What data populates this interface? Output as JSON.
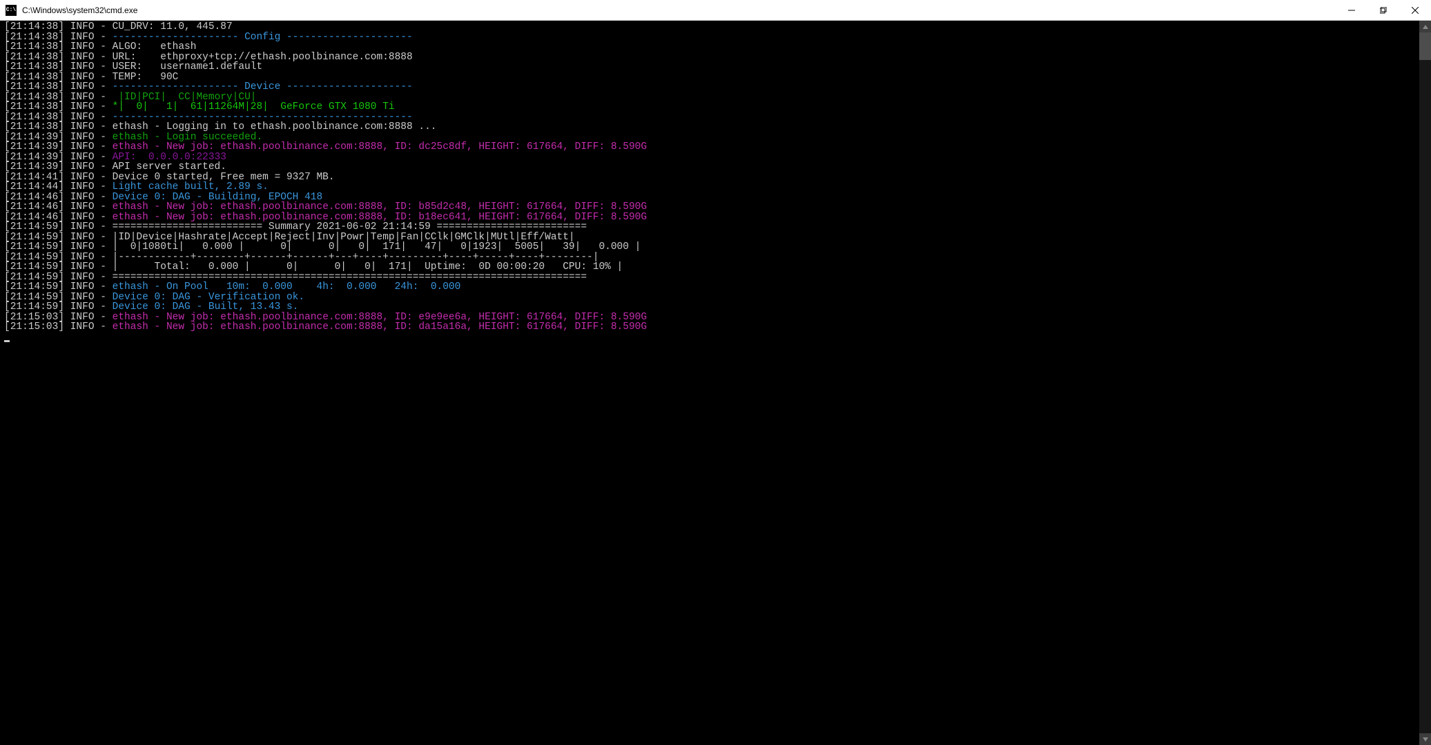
{
  "titlebar": {
    "title": "C:\\Windows\\system32\\cmd.exe"
  },
  "lines": [
    {
      "ts": "[21:14:38]",
      "segs": [
        {
          "c": "c-white",
          "t": " INFO - CU_DRV: 11.0, 445.87"
        }
      ]
    },
    {
      "ts": "[21:14:38]",
      "segs": [
        {
          "c": "c-white",
          "t": " INFO - "
        },
        {
          "c": "c-cyan",
          "t": "--------------------- Config ---------------------"
        }
      ]
    },
    {
      "ts": "[21:14:38]",
      "segs": [
        {
          "c": "c-white",
          "t": " INFO - ALGO:   ethash"
        }
      ]
    },
    {
      "ts": "[21:14:38]",
      "segs": [
        {
          "c": "c-white",
          "t": " INFO - URL:    ethproxy+tcp://ethash.poolbinance.com:8888"
        }
      ]
    },
    {
      "ts": "[21:14:38]",
      "segs": [
        {
          "c": "c-white",
          "t": " INFO - USER:   username1.default"
        }
      ]
    },
    {
      "ts": "[21:14:38]",
      "segs": [
        {
          "c": "c-white",
          "t": " INFO - TEMP:   90C"
        }
      ]
    },
    {
      "ts": "[21:14:38]",
      "segs": [
        {
          "c": "c-white",
          "t": " INFO - "
        },
        {
          "c": "c-cyan",
          "t": "--------------------- Device ---------------------"
        }
      ]
    },
    {
      "ts": "[21:14:38]",
      "segs": [
        {
          "c": "c-white",
          "t": " INFO - "
        },
        {
          "c": "c-green",
          "t": " |ID|PCI|  CC|Memory|CU|"
        }
      ]
    },
    {
      "ts": "[21:14:38]",
      "segs": [
        {
          "c": "c-white",
          "t": " INFO - "
        },
        {
          "c": "c-lgreen",
          "t": "*|  0|   1|  61|11264M|28|  GeForce GTX 1080 Ti"
        }
      ]
    },
    {
      "ts": "[21:14:38]",
      "segs": [
        {
          "c": "c-white",
          "t": " INFO - "
        },
        {
          "c": "c-cyan",
          "t": "--------------------------------------------------"
        }
      ]
    },
    {
      "ts": "[21:14:38]",
      "segs": [
        {
          "c": "c-white",
          "t": " INFO - ethash - Logging in to ethash.poolbinance.com:8888 ..."
        }
      ]
    },
    {
      "ts": "[21:14:39]",
      "segs": [
        {
          "c": "c-white",
          "t": " INFO - "
        },
        {
          "c": "c-green",
          "t": "ethash - Login succeeded."
        }
      ]
    },
    {
      "ts": "[21:14:39]",
      "segs": [
        {
          "c": "c-white",
          "t": " INFO - "
        },
        {
          "c": "c-magenta",
          "t": "ethash - New job: ethash.poolbinance.com:8888, ID: dc25c8df, HEIGHT: 617664, DIFF: 8.590G"
        }
      ]
    },
    {
      "ts": "[21:14:39]",
      "segs": [
        {
          "c": "c-white",
          "t": " INFO - "
        },
        {
          "c": "c-purple",
          "t": "API:  0.0.0.0:22333"
        }
      ]
    },
    {
      "ts": "[21:14:39]",
      "segs": [
        {
          "c": "c-white",
          "t": " INFO - API server started."
        }
      ]
    },
    {
      "ts": "[21:14:41]",
      "segs": [
        {
          "c": "c-white",
          "t": " INFO - Device 0 started, Free mem = 9327 MB."
        }
      ]
    },
    {
      "ts": "[21:14:44]",
      "segs": [
        {
          "c": "c-white",
          "t": " INFO - "
        },
        {
          "c": "c-cyan",
          "t": "Light cache built, 2.89 s."
        }
      ]
    },
    {
      "ts": "[21:14:46]",
      "segs": [
        {
          "c": "c-white",
          "t": " INFO - "
        },
        {
          "c": "c-cyan",
          "t": "Device 0: DAG - Building, EPOCH 418"
        }
      ]
    },
    {
      "ts": "[21:14:46]",
      "segs": [
        {
          "c": "c-white",
          "t": " INFO - "
        },
        {
          "c": "c-magenta",
          "t": "ethash - New job: ethash.poolbinance.com:8888, ID: b85d2c48, HEIGHT: 617664, DIFF: 8.590G"
        }
      ]
    },
    {
      "ts": "[21:14:46]",
      "segs": [
        {
          "c": "c-white",
          "t": " INFO - "
        },
        {
          "c": "c-magenta",
          "t": "ethash - New job: ethash.poolbinance.com:8888, ID: b18ec641, HEIGHT: 617664, DIFF: 8.590G"
        }
      ]
    },
    {
      "ts": "[21:14:59]",
      "segs": [
        {
          "c": "c-white",
          "t": " INFO - ========================= Summary 2021-06-02 21:14:59 ========================="
        }
      ]
    },
    {
      "ts": "[21:14:59]",
      "segs": [
        {
          "c": "c-white",
          "t": " INFO - |ID|Device|Hashrate|Accept|Reject|Inv|Powr|Temp|Fan|CClk|GMClk|MUtl|Eff/Watt|"
        }
      ]
    },
    {
      "ts": "[21:14:59]",
      "segs": [
        {
          "c": "c-white",
          "t": " INFO - |  0|1080ti|   0.000 |      0|      0|   0|  171|   47|   0|1923|  5005|   39|   0.000 |"
        }
      ]
    },
    {
      "ts": "[21:14:59]",
      "segs": [
        {
          "c": "c-white",
          "t": " INFO - |------------+--------+------+------+---+----+---------+----+-----+----+--------|"
        }
      ]
    },
    {
      "ts": "[21:14:59]",
      "segs": [
        {
          "c": "c-white",
          "t": " INFO - |      Total:   0.000 |      0|      0|   0|  171|  Uptime:  0D 00:00:20   CPU: 10% |"
        }
      ]
    },
    {
      "ts": "[21:14:59]",
      "segs": [
        {
          "c": "c-white",
          "t": " INFO - ==============================================================================="
        }
      ]
    },
    {
      "ts": "[21:14:59]",
      "segs": [
        {
          "c": "c-white",
          "t": " INFO - "
        },
        {
          "c": "c-cyan",
          "t": "ethash - On Pool   10m:  0.000    4h:  0.000   24h:  0.000"
        }
      ]
    },
    {
      "ts": "[21:14:59]",
      "segs": [
        {
          "c": "c-white",
          "t": " INFO - "
        },
        {
          "c": "c-cyan",
          "t": "Device 0: DAG - Verification ok."
        }
      ]
    },
    {
      "ts": "[21:14:59]",
      "segs": [
        {
          "c": "c-white",
          "t": " INFO - "
        },
        {
          "c": "c-cyan",
          "t": "Device 0: DAG - Built, 13.43 s."
        }
      ]
    },
    {
      "ts": "[21:15:03]",
      "segs": [
        {
          "c": "c-white",
          "t": " INFO - "
        },
        {
          "c": "c-magenta",
          "t": "ethash - New job: ethash.poolbinance.com:8888, ID: e9e9ee6a, HEIGHT: 617664, DIFF: 8.590G"
        }
      ]
    },
    {
      "ts": "[21:15:03]",
      "segs": [
        {
          "c": "c-white",
          "t": " INFO - "
        },
        {
          "c": "c-magenta",
          "t": "ethash - New job: ethash.poolbinance.com:8888, ID: da15a16a, HEIGHT: 617664, DIFF: 8.590G"
        }
      ]
    }
  ]
}
